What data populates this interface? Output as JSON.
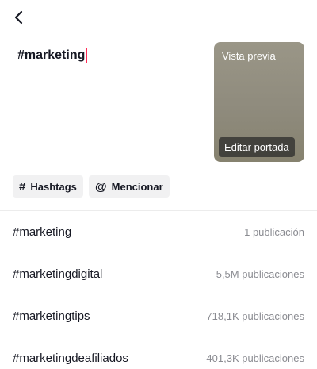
{
  "header": {
    "back_icon": "chevron-left-icon"
  },
  "caption": {
    "text": "#marketing"
  },
  "preview": {
    "label": "Vista previa",
    "edit_cover_label": "Editar portada"
  },
  "chips": {
    "hashtags": {
      "icon": "#",
      "label": "Hashtags"
    },
    "mention": {
      "icon": "@",
      "label": "Mencionar"
    }
  },
  "suggestions": [
    {
      "tag": "#marketing",
      "count": "1 publicación"
    },
    {
      "tag": "#marketingdigital",
      "count": "5,5M publicaciones"
    },
    {
      "tag": "#marketingtips",
      "count": "718,1K publicaciones"
    },
    {
      "tag": "#marketingdeafiliados",
      "count": "401,3K publicaciones"
    }
  ],
  "colors": {
    "caret": "#fe2c55",
    "text_primary": "#161823",
    "text_secondary": "#8a8b91",
    "chip_bg": "#f1f1f2"
  }
}
